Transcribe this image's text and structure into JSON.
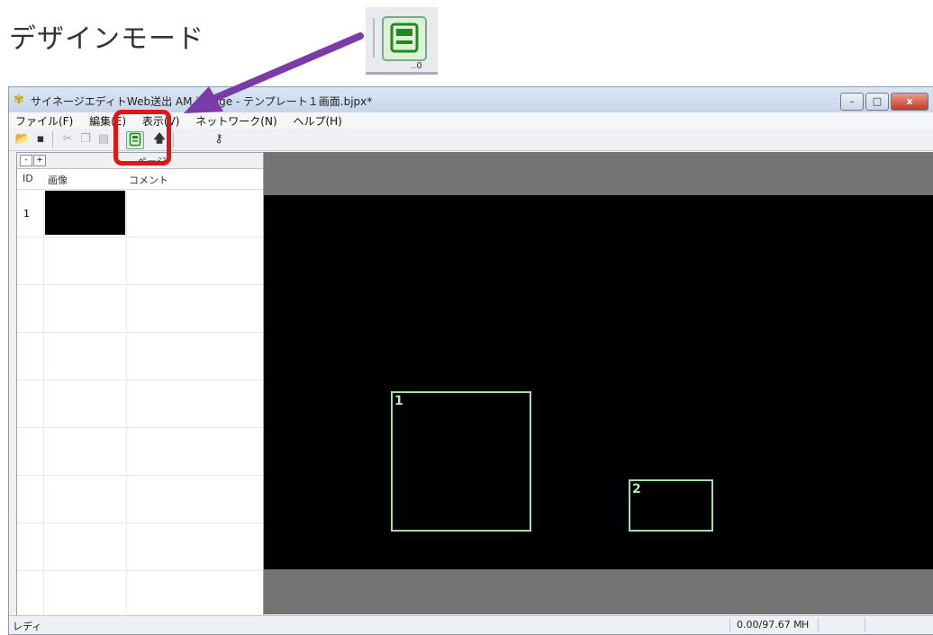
{
  "caption": "デザインモード",
  "zoom_extra": "..0",
  "window": {
    "title": "サイネージエディトWeb送出 AM      ignage - テンプレート１画面.bjpx*",
    "min_label": "–",
    "max_label": "□",
    "close_label": "x"
  },
  "menu": {
    "file": "ファイル(F)",
    "edit": "編集(E)",
    "view": "表示(V)",
    "network": "ネットワーク(N)",
    "help": "ヘルプ(H)"
  },
  "toolbar": {
    "open_icon": "open-folder-icon",
    "save_icon": "save-icon",
    "cut_icon": "cut-icon",
    "copy_icon": "copy-icon",
    "paste_icon": "paste-icon",
    "design_icon": "design-mode-icon",
    "upload_icon": "upload-arrow-icon",
    "key_icon": "key-icon"
  },
  "left_panel": {
    "minus_label": "-",
    "plus_label": "+",
    "tab_label": "ページ",
    "columns": [
      "ID",
      "画像",
      "コメント"
    ],
    "rows": [
      {
        "id": "1",
        "comment": ""
      }
    ]
  },
  "canvas": {
    "regions": [
      {
        "label": "1"
      },
      {
        "label": "2"
      }
    ],
    "region_border_color": "#a8dca8"
  },
  "status": {
    "left": "レディ",
    "memory": "0.00/97.67 M",
    "mode": "H"
  },
  "annotation": {
    "highlight_color": "#e21414",
    "arrow_color": "#7a3aa8"
  }
}
